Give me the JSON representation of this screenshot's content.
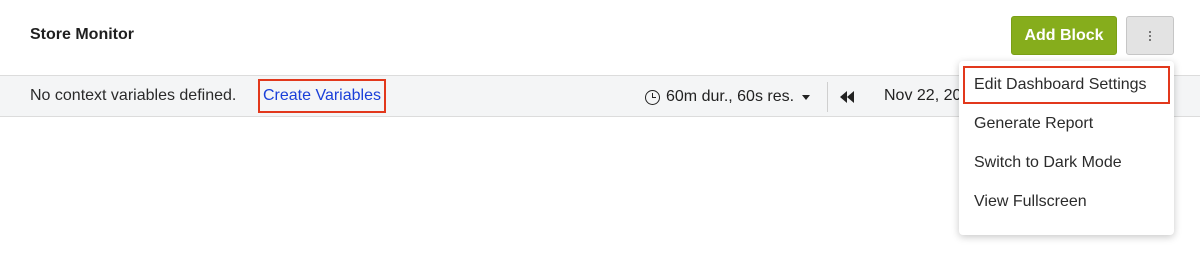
{
  "header": {
    "title": "Store Monitor",
    "add_block_label": "Add Block",
    "more_icon": "kebab-vertical-icon",
    "accent_color": "#86ad1c"
  },
  "context_bar": {
    "no_vars_text": "No context variables defined.",
    "create_vars_link": "Create Variables",
    "time_range_label": "60m dur., 60s res.",
    "date_text": "Nov 22, 20"
  },
  "menu": {
    "items": [
      {
        "label": "Edit Dashboard Settings"
      },
      {
        "label": "Generate Report"
      },
      {
        "label": "Switch to Dark Mode"
      },
      {
        "label": "View Fullscreen"
      }
    ]
  }
}
